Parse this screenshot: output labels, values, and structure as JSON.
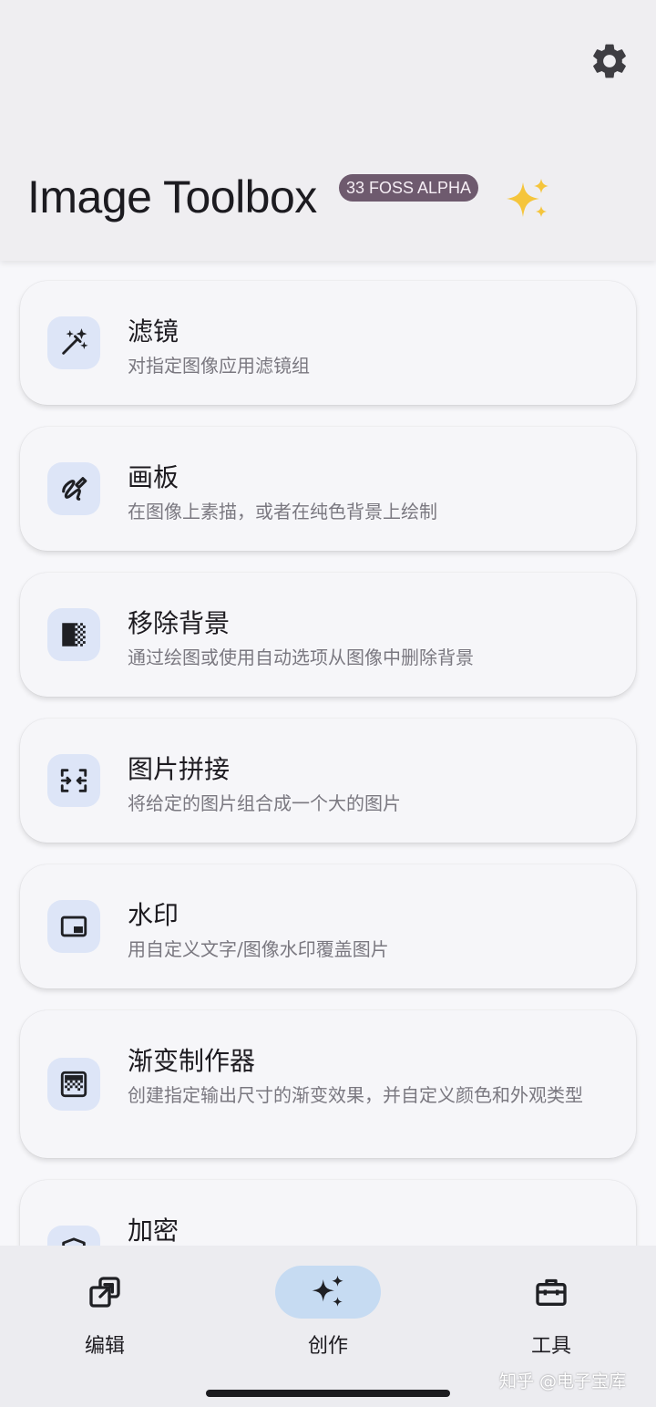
{
  "header": {
    "title": "Image Toolbox",
    "badge": "33 FOSS  ALPHA",
    "settings_icon": "gear-icon",
    "decor_icon": "sparkles-icon"
  },
  "tools": [
    {
      "title": "滤镜",
      "desc": "对指定图像应用滤镜组",
      "icon": "magic-wand-icon"
    },
    {
      "title": "画板",
      "desc": "在图像上素描，或者在纯色背景上绘制",
      "icon": "draw-icon"
    },
    {
      "title": "移除背景",
      "desc": "通过绘图或使用自动选项从图像中删除背景",
      "icon": "transparency-icon"
    },
    {
      "title": "图片拼接",
      "desc": "将给定的图片组合成一个大的图片",
      "icon": "stitch-icon"
    },
    {
      "title": "水印",
      "desc": "用自定义文字/图像水印覆盖图片",
      "icon": "picture-in-picture-icon"
    },
    {
      "title": "渐变制作器",
      "desc": "创建指定输出尺寸的渐变效果，并自定义颜色和外观类型",
      "icon": "gradient-icon"
    },
    {
      "title": "加密",
      "desc": "",
      "icon": "shield-icon"
    }
  ],
  "nav": {
    "items": [
      {
        "label": "编辑",
        "icon": "edit-open-icon"
      },
      {
        "label": "创作",
        "icon": "sparkles-icon",
        "active": true
      },
      {
        "label": "工具",
        "icon": "toolbox-icon"
      }
    ]
  },
  "watermark": "知乎 @电子宝库",
  "colors": {
    "accent_pill": "#c6dbf2",
    "icon_bg": "#dde5f7",
    "badge_bg": "#6e5a6e"
  }
}
